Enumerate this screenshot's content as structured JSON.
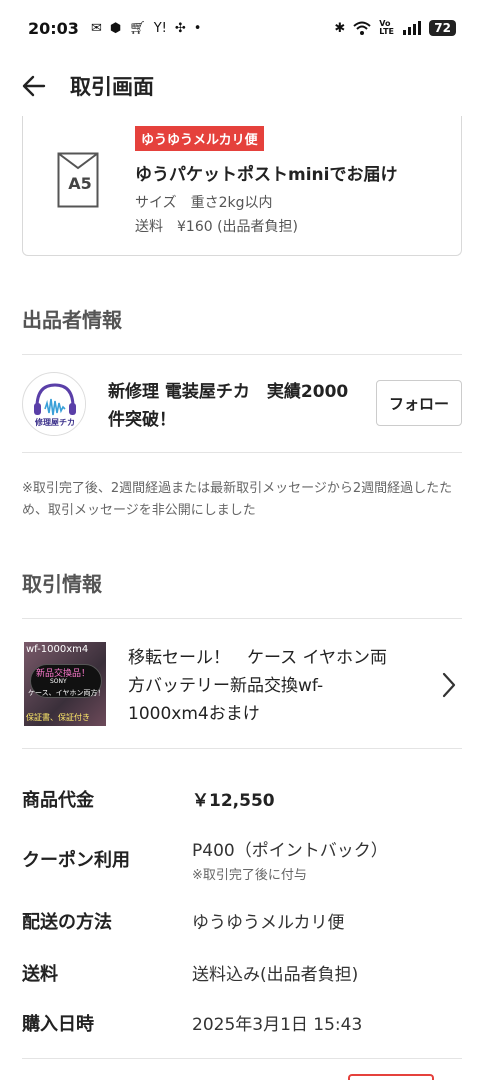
{
  "status_bar": {
    "time": "20:03",
    "battery": "72",
    "network_label": "Vo LTE"
  },
  "app_bar": {
    "title": "取引画面"
  },
  "shipping": {
    "tag": "ゆうゆうメルカリ便",
    "envelope_label": "A5",
    "name": "ゆうパケットポストminiでお届け",
    "size": "サイズ　重さ2kg以内",
    "fee": "送料　¥160 (出品者負担)"
  },
  "seller_section": {
    "heading": "出品者情報",
    "seller_name": "新修理 電装屋チカ　実績2000件突破！",
    "avatar_text": "修理屋チカ",
    "follow_label": "フォロー",
    "notice": "※取引完了後、2週間経過または最新取引メッセージから2週間経過したため、取引メッセージを非公開にしました"
  },
  "transaction_section": {
    "heading": "取引情報",
    "product": {
      "title": "移転セール！　ケース イヤホン両方バッテリー新品交換wf-1000xm4おまけ",
      "thumb_text_1": "wf-1000xm4",
      "thumb_text_2": "新品交換品！",
      "thumb_text_3": "SONY",
      "thumb_text_4": "ケース、イヤホン両方！",
      "thumb_text_5": "保証書、保証付き"
    },
    "rows": [
      {
        "label": "商品代金",
        "value": "￥12,550"
      },
      {
        "label": "クーポン利用",
        "value": "P400（ポイントバック）",
        "sub": "※取引完了後に付与"
      },
      {
        "label": "配送の方法",
        "value": "ゆうゆうメルカリ便"
      },
      {
        "label": "送料",
        "value": "送料込み(出品者負担)"
      },
      {
        "label": "購入日時",
        "value": "2025年3月1日 15:43"
      }
    ]
  },
  "colors": {
    "accent_red": "#e5413c",
    "avatar_purple": "#5a3fa8",
    "text_primary": "#222222",
    "text_secondary": "#666666",
    "divider": "#e4e4e4"
  }
}
